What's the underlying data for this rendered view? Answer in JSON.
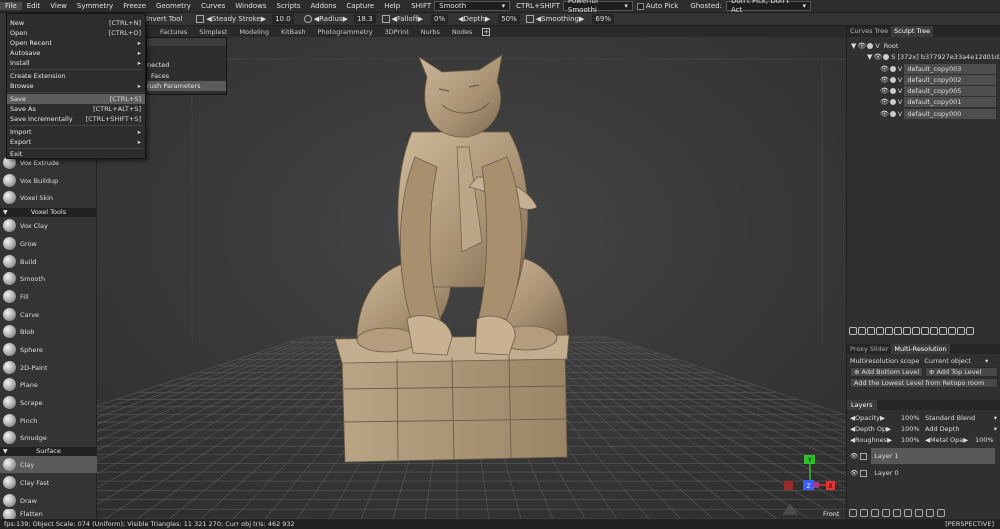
{
  "menubar": {
    "items": [
      "File",
      "Edit",
      "View",
      "Symmetry",
      "Freeze",
      "Geometry",
      "Curves",
      "Windows",
      "Scripts",
      "Addons",
      "Capture",
      "Help"
    ],
    "shift_label": "SHIFT",
    "shift_value": "Smooth",
    "ctrl_shift_label": "CTRL+SHIFT",
    "ctrl_shift_value": "Powerful Smoothi",
    "auto_pick_label": "Auto Pick",
    "ghosted_label": "Ghosted:",
    "ghosted_value": "Don't Pick, Don't Act"
  },
  "toolbar": {
    "invert_tool": "Invert Tool",
    "steady_stroke": "Steady Stroke",
    "steady_value": "10.0",
    "radius_label": "Radius",
    "radius_value": "18.3",
    "falloff_label": "Falloff",
    "falloff_value": "0%",
    "depth_label": "Depth",
    "depth_value": "50%",
    "smoothing_label": "Smoothing",
    "smoothing_value": "69%"
  },
  "tabs": [
    "Factures",
    "Simplest",
    "Modeling",
    "KitBash",
    "Photogrammetry",
    "3DPrint",
    "Nurbs",
    "Nodes"
  ],
  "file_menu": {
    "items": [
      {
        "label": "New",
        "shortcut": "[CTRL+N]"
      },
      {
        "label": "Open",
        "shortcut": "[CTRL+O]"
      },
      {
        "label": "Open Recent",
        "shortcut": "▸"
      },
      {
        "label": "Autosave",
        "shortcut": "▸"
      },
      {
        "label": "Install",
        "shortcut": "▸"
      },
      {
        "label": "Create Extension",
        "shortcut": ""
      },
      {
        "label": "Browse",
        "shortcut": "▸"
      },
      {
        "label": "Save",
        "shortcut": "[CTRL+S]"
      },
      {
        "label": "Save As",
        "shortcut": "[CTRL+ALT+S]"
      },
      {
        "label": "Save Incrementally",
        "shortcut": "[CTRL+SHIFT+S]"
      },
      {
        "label": "Import",
        "shortcut": "▸"
      },
      {
        "label": "Export",
        "shortcut": "▸"
      },
      {
        "label": "Exit",
        "shortcut": ""
      }
    ]
  },
  "submenu": {
    "items": [
      "nected",
      "Faces",
      "rush Parameters"
    ]
  },
  "toolbox": {
    "voxel_top": [
      "Vox Extrude",
      "Vox Buildup",
      "Voxel Skin"
    ],
    "section_voxel": "Voxel Tools",
    "voxel_tools": [
      "Vox Clay",
      "Grow",
      "Build",
      "Smooth",
      "Fill",
      "Carve",
      "Blob",
      "Sphere",
      "2D-Paint",
      "Plane",
      "Scrape",
      "Pinch",
      "Smudge"
    ],
    "section_surface": "Surface",
    "surface_tools": [
      "Clay",
      "Clay Fast",
      "Draw",
      "Flatten"
    ]
  },
  "viewport": {
    "projection": "Front",
    "axis_x": "X",
    "axis_y": "Y",
    "axis_z": "Z"
  },
  "right_panel": {
    "tabs": [
      "Curves Tree",
      "Sculpt Tree"
    ],
    "tree_root": "Root",
    "tree_group": "S  [372x]  b377927e33a4e12d01d3",
    "tree_items": [
      "default_copy003",
      "default_copy002",
      "default_copy005",
      "default_copy001",
      "default_copy000"
    ],
    "subtabs": [
      "Proxy Slider",
      "Multi-Resolution"
    ],
    "multires_scope_label": "Multiresolution  scope",
    "multires_scope_value": "Current object",
    "add_bottom_level": "Add Bottom Level",
    "add_top_level": "Add Top Level",
    "add_lowest_level": "Add the Lowest Level from Retopo room",
    "layers_title": "Layers",
    "opacity_label": "Opacity",
    "opacity_value": "100%",
    "blend_value": "Standard Blend",
    "depth_op_label": "Depth Op",
    "depth_op_value": "100%",
    "add_depth_value": "Add Depth",
    "roughness_label": "Roughnes",
    "roughness_value": "100%",
    "metal_label": "Metal Opa",
    "metal_value": "100%",
    "layers": [
      "Layer 1",
      "Layer 0"
    ]
  },
  "status": {
    "left": "fps:139;      Object Scale: 074 (Uniform);  Visible Triangles: 11 321 270;  Curr obj  tris: 462 932",
    "right": "[PERSPECTIVE]"
  },
  "colors": {
    "statue": "#b8a283",
    "grid": "#555555",
    "axis_x": "#e23434",
    "axis_y": "#2fbf2f",
    "axis_z": "#3a5cff"
  }
}
